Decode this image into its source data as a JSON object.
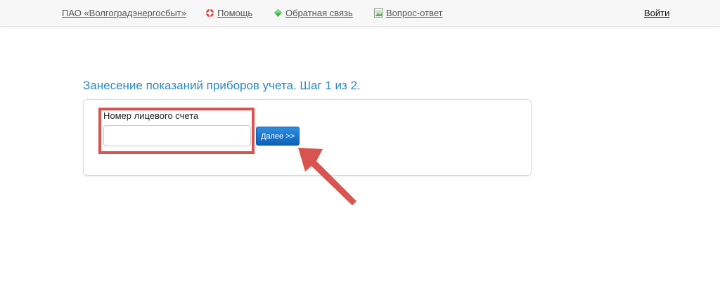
{
  "header": {
    "company_link": "ПАО «Волгоградэнергосбыт»",
    "help_link": "Помощь",
    "feedback_link": "Обратная связь",
    "faq_link": "Вопрос-ответ",
    "login_link": "Войти"
  },
  "icons": {
    "help": "lifebuoy-icon",
    "feedback": "diamond-icon",
    "faq": "image-icon"
  },
  "page": {
    "title": "Занесение показаний приборов учета. Шаг 1 из 2.",
    "account_label": "Номер лицевого счета",
    "account_value": "",
    "account_placeholder": "",
    "next_button": "Далее >>"
  },
  "colors": {
    "title": "#2a8bc0",
    "button": "#0b63b6",
    "annotation": "#d9534f"
  }
}
